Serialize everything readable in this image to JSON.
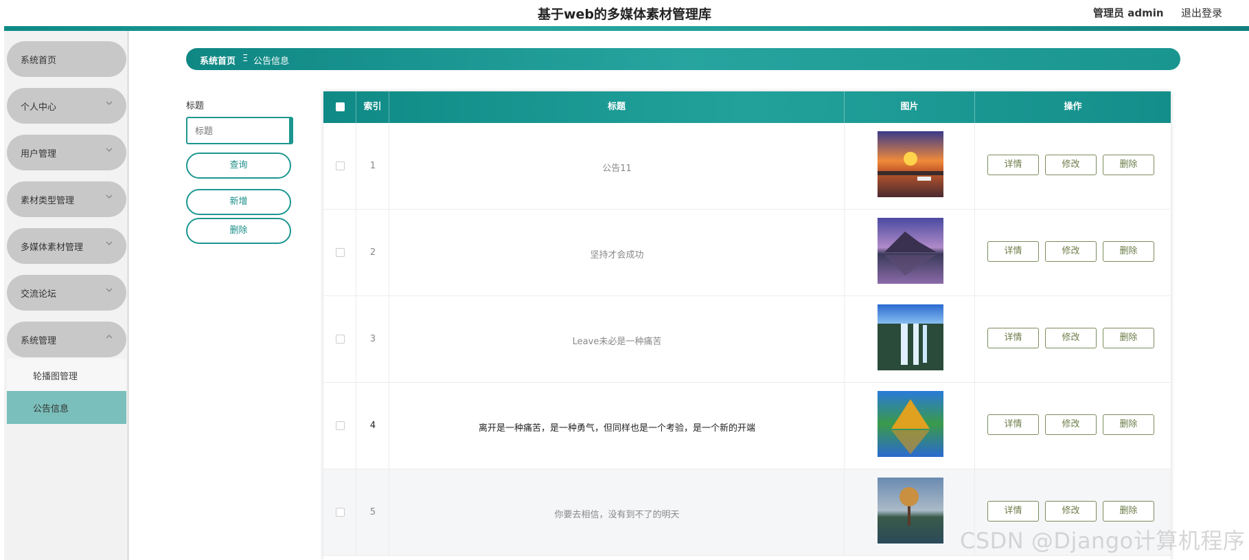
{
  "header": {
    "title": "基于web的多媒体素材管理库",
    "admin": "管理员 admin",
    "logout": "退出登录"
  },
  "sidebar": {
    "items": [
      {
        "label": "系统首页",
        "has_chevron": false
      },
      {
        "label": "个人中心",
        "has_chevron": true
      },
      {
        "label": "用户管理",
        "has_chevron": true
      },
      {
        "label": "素材类型管理",
        "has_chevron": true
      },
      {
        "label": "多媒体素材管理",
        "has_chevron": true
      },
      {
        "label": "交流论坛",
        "has_chevron": true
      },
      {
        "label": "系统管理",
        "has_chevron": true,
        "expanded": true
      }
    ],
    "sub_items": [
      {
        "label": "轮播图管理",
        "active": false
      },
      {
        "label": "公告信息",
        "active": true
      }
    ]
  },
  "breadcrumb": {
    "home": "系统首页",
    "separator": "Ξ",
    "current": "公告信息"
  },
  "search": {
    "label": "标题",
    "placeholder": "标题",
    "value": ""
  },
  "actions": {
    "query": "查询",
    "add": "新增",
    "delete": "删除"
  },
  "table": {
    "headers": [
      "索引",
      "标题",
      "图片",
      "操作"
    ],
    "row_actions": {
      "detail": "详情",
      "edit": "修改",
      "delete": "删除"
    },
    "rows": [
      {
        "index": "1",
        "title": "公告11",
        "image": "sunset-lake"
      },
      {
        "index": "2",
        "title": "坚持才会成功",
        "image": "mountain-reflection"
      },
      {
        "index": "3",
        "title": "Leave未必是一种痛苦",
        "image": "waterfall"
      },
      {
        "index": "4",
        "title": "离开是一种痛苦，是一种勇气，但同样也是一个考验，是一个新的开端",
        "image": "autumn-mountain"
      },
      {
        "index": "5",
        "title": "你要去相信，没有到不了的明天",
        "image": "tree-lake"
      }
    ]
  },
  "watermark": "CSDN @Django计算机程序",
  "colors": {
    "primary": "#1b9690",
    "sidebar_active": "#7abfbb",
    "menu_bg": "#c8c8c8",
    "op_border": "#7a8a5a"
  }
}
